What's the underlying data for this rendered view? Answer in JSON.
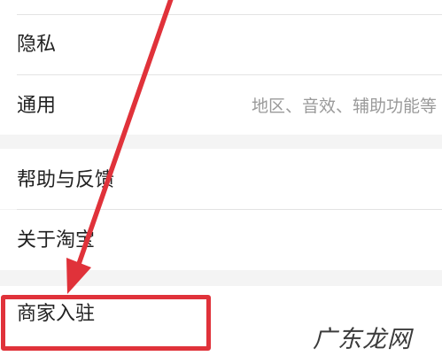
{
  "settings": {
    "items": [
      {
        "label": "隐私",
        "hint": ""
      },
      {
        "label": "通用",
        "hint": "地区、音效、辅助功能等"
      },
      {
        "label": "帮助与反馈",
        "hint": ""
      },
      {
        "label": "关于淘宝",
        "hint": ""
      },
      {
        "label": "商家入驻",
        "hint": ""
      }
    ]
  },
  "watermark": {
    "text": "广东龙网"
  },
  "annotation": {
    "color": "#e0323a"
  }
}
